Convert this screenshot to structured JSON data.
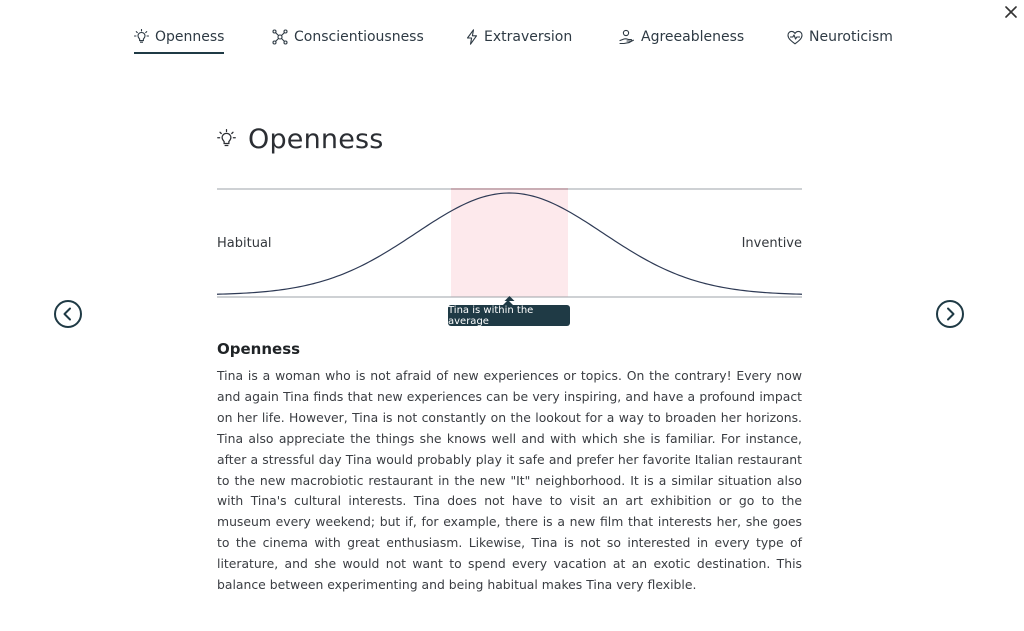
{
  "close": {
    "icon": "close-icon"
  },
  "tabs": [
    {
      "label": "Openness",
      "icon": "lightbulb-icon",
      "active": true
    },
    {
      "label": "Conscientiousness",
      "icon": "network-icon",
      "active": false
    },
    {
      "label": "Extraversion",
      "icon": "lightning-icon",
      "active": false
    },
    {
      "label": "Agreeableness",
      "icon": "handshake-icon",
      "active": false
    },
    {
      "label": "Neuroticism",
      "icon": "heart-pulse-icon",
      "active": false
    }
  ],
  "heading": {
    "icon": "lightbulb-icon",
    "title": "Openness"
  },
  "chart_data": {
    "type": "area",
    "left_label": "Habitual",
    "right_label": "Inventive",
    "average_band": [
      0.4,
      0.6
    ],
    "marker_position": 0.5,
    "tooltip": "Tina is within the average",
    "colors": {
      "curve": "#2e3a55",
      "band": "#fde9ec",
      "band_edge": "#f4b7c0",
      "line": "#9ea3a8"
    }
  },
  "nav": {
    "prev_icon": "chevron-left-icon",
    "next_icon": "chevron-right-icon"
  },
  "section": {
    "title": "Openness",
    "body": "Tina is a woman who is not afraid of new experiences or topics. On the contrary! Every now and again Tina finds that new experiences can be very inspiring, and have a profound impact on her life. However, Tina is not constantly on the lookout for a way to broaden her horizons. Tina also appreciate the things she knows well and with which she is familiar. For instance, after a stressful day Tina would probably play it safe and prefer her favorite Italian restaurant to the new macrobiotic restaurant in the new \"It\" neighborhood. It is a similar situation also with Tina's cultural interests. Tina does not have to visit an art exhibition or go to the museum every weekend; but if, for example, there is a new film that interests her, she goes to the cinema with great enthusiasm. Likewise, Tina is not so interested in every type of literature, and she would not want to spend every vacation at an exotic destination. This balance between experimenting and being habitual makes Tina very flexible."
  }
}
